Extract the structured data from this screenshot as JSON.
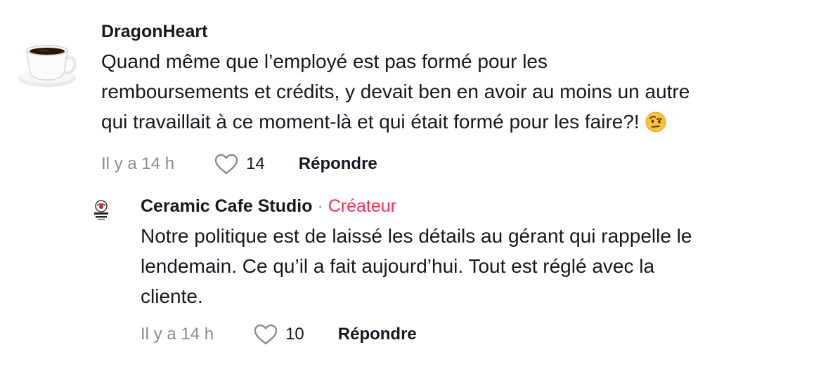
{
  "comments": [
    {
      "username": "DragonHeart",
      "text_lines": [
        "Quand même que l’employé est pas formé pour les",
        "remboursements et crédits, y devait ben en avoir au moins un autre",
        "qui travaillait à ce moment-là et qui était formé pour les faire?!"
      ],
      "emoji_icon": "face-with-raised-eyebrow-icon",
      "avatar_icon": "coffee-cup-icon",
      "time": "Il y a 14 h",
      "likes": "14",
      "reply_label": "Répondre"
    },
    {
      "username": "Ceramic Cafe Studio",
      "separator": " · ",
      "creator_label": "Créateur",
      "text_lines": [
        "Notre politique est de laissé les détails au gérant qui rappelle le",
        "lendemain. Ce qu’il a fait aujourd’hui. Tout est réglé avec la",
        "cliente."
      ],
      "avatar_icon": "ceramic-cafe-logo",
      "avatar_logo_text": "CERAMIC CAFE STUDIO",
      "time": "Il y a 14 h",
      "likes": "10",
      "reply_label": "Répondre"
    }
  ],
  "colors": {
    "text": "#161823",
    "muted": "#8a8b91",
    "creator": "#fe2c55"
  }
}
